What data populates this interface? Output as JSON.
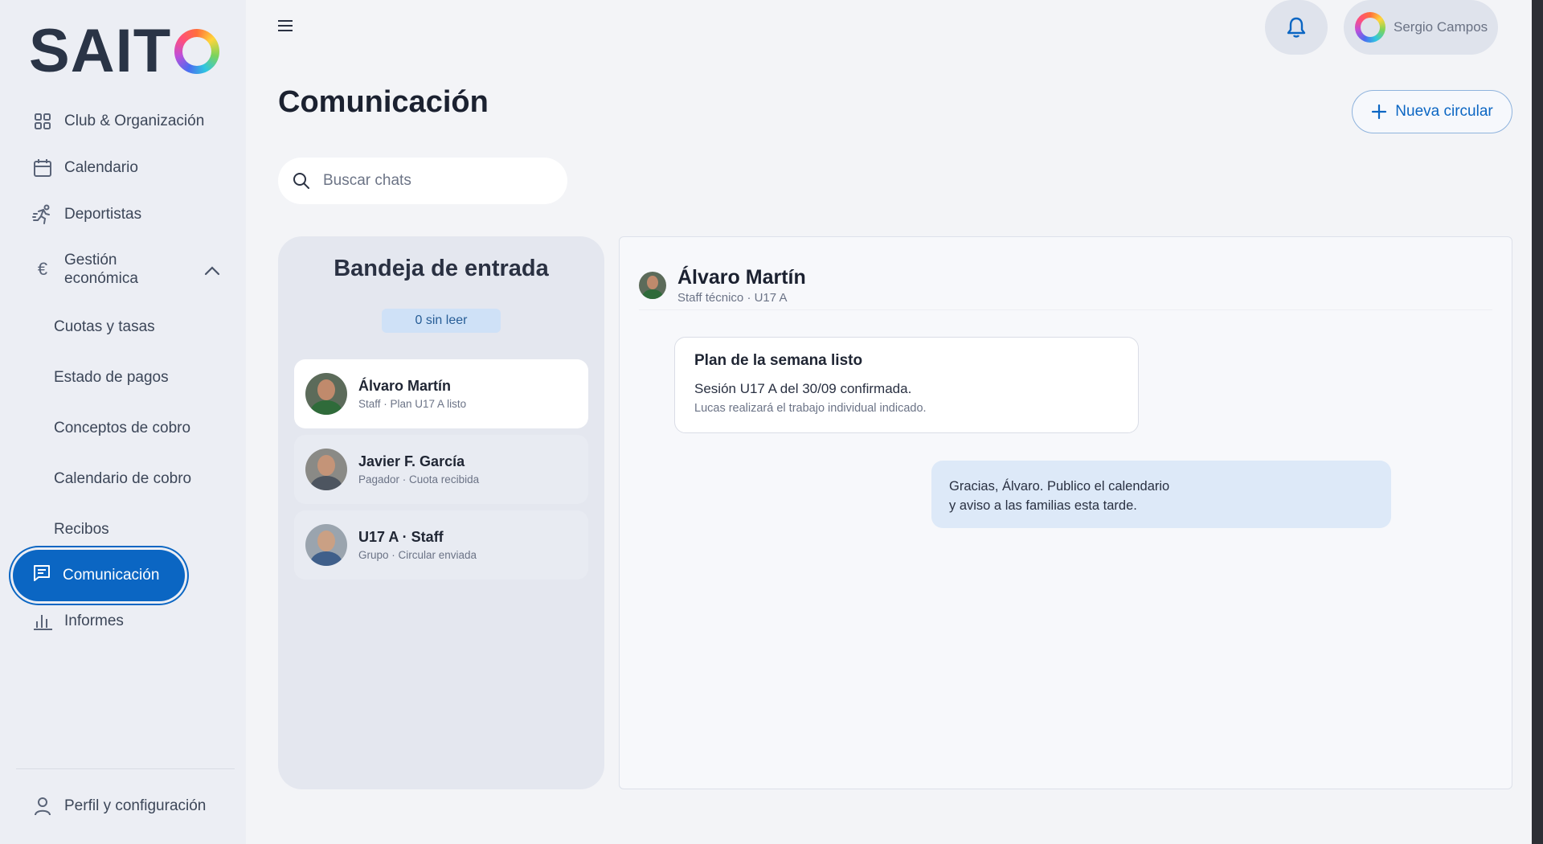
{
  "brand": {
    "logo_text": "SAIT"
  },
  "sidebar": {
    "items": [
      {
        "label": "Club & Organización",
        "icon": "grid-icon"
      },
      {
        "label": "Calendario",
        "icon": "calendar-icon"
      },
      {
        "label": "Deportistas",
        "icon": "runner-icon"
      },
      {
        "label": "Gestión económica",
        "icon": "euro-icon"
      },
      {
        "label": "Comunicación",
        "icon": "chat-icon"
      },
      {
        "label": "Informes",
        "icon": "bar-chart-icon"
      }
    ],
    "economic_sub": [
      "Cuotas y tasas",
      "Estado de pagos",
      "Conceptos de cobro",
      "Calendario de cobro",
      "Recibos"
    ],
    "economic_label_line1": "Gestión",
    "economic_label_line2": "económica",
    "profile_label": "Perfil y configuración"
  },
  "header": {
    "user_name": "Sergio Campos"
  },
  "page": {
    "title": "Comunicación",
    "new_button_label": "Nueva circular",
    "search_placeholder": "Buscar chats"
  },
  "inbox": {
    "title": "Bandeja de entrada",
    "unread": "0 sin leer",
    "chats": [
      {
        "name": "Álvaro Martín",
        "sub": "Staff · Plan U17 A listo"
      },
      {
        "name": "Javier F. García",
        "sub": "Pagador · Cuota recibida"
      },
      {
        "name": "U17 A · Staff",
        "sub": "Grupo · Circular enviada"
      }
    ]
  },
  "conversation": {
    "name": "Álvaro Martín",
    "sub": "Staff técnico · U17 A",
    "incoming": {
      "title": "Plan de la semana listo",
      "text": "Sesión U17 A del 30/09 confirmada.",
      "note": "Lucas realizará el trabajo individual indicado."
    },
    "outgoing": {
      "line1": "Gracias, Álvaro. Publico el calendario",
      "line2": "y aviso a las familias esta tarde."
    }
  },
  "colors": {
    "accent": "#0b66c3",
    "badge_bg": "#cfe1f7",
    "outgoing_bg": "#dde9f8"
  }
}
